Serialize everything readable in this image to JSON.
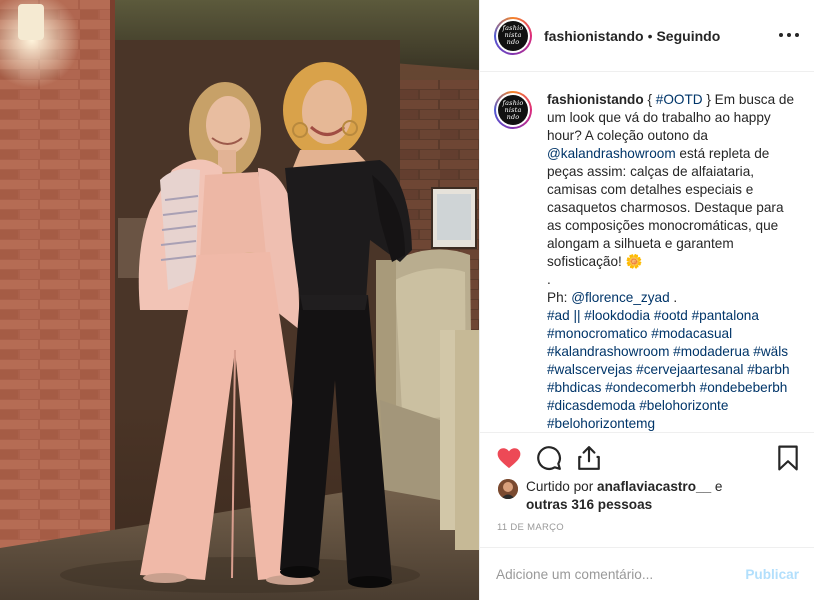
{
  "post": {
    "username": "fashionistando",
    "separator": "•",
    "follow_status": "Seguindo",
    "avatar_text": "fashio nista ndo"
  },
  "caption": {
    "username": "fashionistando",
    "part1": " { ",
    "tag_ootd": "#OOTD",
    "part2": " } Em busca de um look que vá do trabalho ao happy hour? A coleção outono da ",
    "mention_store": "@kalandrashowroom",
    "part3": " está repleta de peças assim: calças de alfaiataria, camisas com detalhes especiais e casaquetos charmosos. Destaque para as composições monocromáticas, que alongam a silhueta e garantem sofisticação! 🌼\n.\nPh: ",
    "mention_photo": "@florence_zyad",
    "part4": " .\n",
    "hashtags": "#ad || #lookdodia #ootd #pantalona #monocromatico #modacasual #kalandrashowroom #modaderua #wäls #walscervejas #cervejaartesanal #barbh #bhdicas #ondecomerbh #ondebeberbh #dicasdemoda #belohorizonte #belohorizontemg"
  },
  "likes": {
    "prefix": "Curtido por ",
    "user": "anaflaviacastro__",
    "middle": " e ",
    "others": "outras 316 pessoas"
  },
  "date": "11 DE MARÇO",
  "comment": {
    "placeholder": "Adicione um comentário...",
    "publish_label": "Publicar"
  },
  "colors": {
    "heart": "#ed4956",
    "link": "#003569",
    "publish_disabled": "#b2dffc",
    "date": "#999999"
  },
  "icons": {
    "more": "more-options-icon",
    "like": "heart-icon",
    "comment": "comment-icon",
    "share": "share-icon",
    "save": "bookmark-icon"
  }
}
